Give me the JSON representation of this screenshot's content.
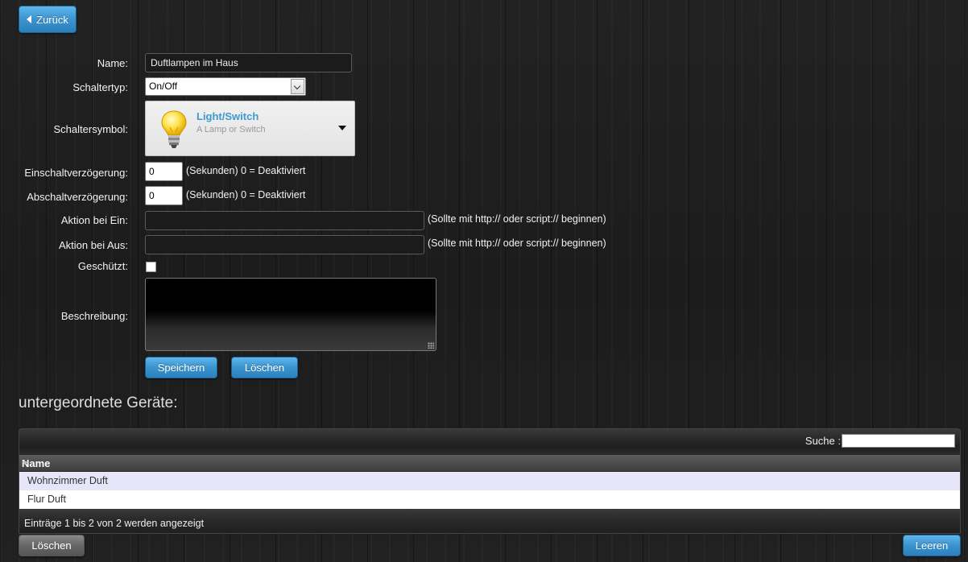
{
  "nav": {
    "back_label": "Zurück"
  },
  "form": {
    "name_label": "Name:",
    "name_value": "Duftlampen im Haus",
    "type_label": "Schaltertyp:",
    "type_value": "On/Off",
    "icon_label": "Schaltersymbol:",
    "icon_title": "Light/Switch",
    "icon_subtitle": "A Lamp or Switch",
    "on_delay_label": "Einschaltverzögerung:",
    "on_delay_value": "0",
    "on_delay_hint": "(Sekunden) 0 = Deaktiviert",
    "off_delay_label": "Abschaltverzögerung:",
    "off_delay_value": "0",
    "off_delay_hint": "(Sekunden) 0 = Deaktiviert",
    "action_on_label": "Aktion bei Ein:",
    "action_on_value": "",
    "action_on_hint": "(Sollte mit http:// oder script:// beginnen)",
    "action_off_label": "Aktion bei Aus:",
    "action_off_value": "",
    "action_off_hint": "(Sollte mit http:// oder script:// beginnen)",
    "protected_label": "Geschützt:",
    "protected_checked": false,
    "description_label": "Beschreibung:",
    "save_label": "Speichern",
    "delete_label": "Löschen"
  },
  "children": {
    "title": "untergeordnete Geräte:",
    "search_label": "Suche :",
    "search_value": "",
    "column_name": "Name",
    "rows": [
      {
        "name": "Wohnzimmer Duft"
      },
      {
        "name": "Flur Duft"
      }
    ],
    "info": "Einträge 1 bis 2 von 2 werden angezeigt",
    "delete_label": "Löschen",
    "clear_label": "Leeren"
  },
  "colors": {
    "accent": "#3a93cf",
    "icon_title": "#3d9ad1"
  }
}
